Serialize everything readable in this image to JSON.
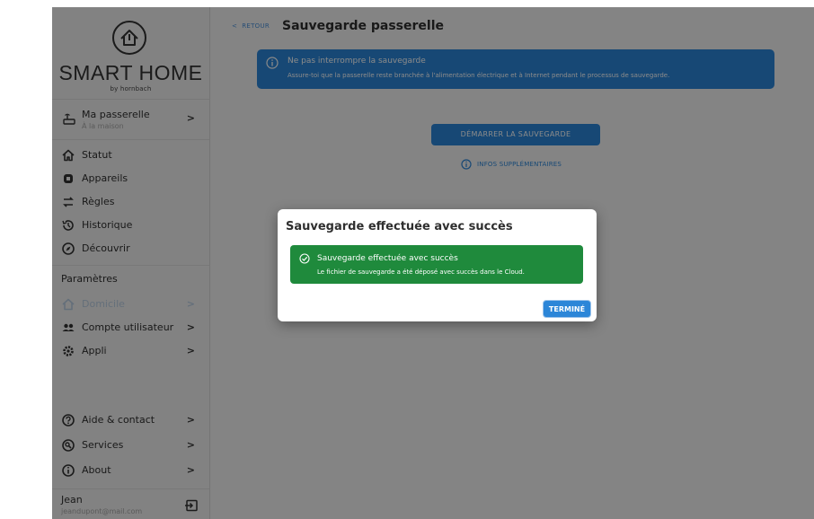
{
  "brand": {
    "title": "SMART HOME",
    "subtitle": "by hornbach"
  },
  "gateway": {
    "title": "Ma passerelle",
    "subtitle": "À la maison",
    "icon": "gateway-icon"
  },
  "nav": [
    {
      "label": "Statut",
      "icon": "home-icon"
    },
    {
      "label": "Appareils",
      "icon": "device-icon"
    },
    {
      "label": "Règles",
      "icon": "rules-icon"
    },
    {
      "label": "Historique",
      "icon": "history-icon"
    },
    {
      "label": "Découvrir",
      "icon": "compass-icon"
    }
  ],
  "settings": {
    "section_label": "Paramètres",
    "items": [
      {
        "label": "Domicile",
        "icon": "home-icon",
        "disabled": true
      },
      {
        "label": "Compte utilisateur",
        "icon": "users-icon"
      },
      {
        "label": "Appli",
        "icon": "gear-icon"
      }
    ]
  },
  "bottom_nav": [
    {
      "label": "Aide & contact",
      "icon": "help-icon"
    },
    {
      "label": "Services",
      "icon": "services-icon"
    },
    {
      "label": "About",
      "icon": "info-icon"
    }
  ],
  "user": {
    "name": "Jean",
    "email": "jeandupont@mail.com"
  },
  "header": {
    "back_label": "RETOUR",
    "title": "Sauvegarde passerelle"
  },
  "banner": {
    "title": "Ne pas interrompre la sauvegarde",
    "text": "Assure-toi que la passerelle reste branchée à l'alimentation électrique et à Internet pendant le processus de sauvegarde."
  },
  "actions": {
    "start_label": "DÉMARRER LA SAUVEGARDE",
    "infos_label": "INFOS SUPPLÉMENTAIRES"
  },
  "dialog": {
    "title": "Sauvegarde effectuée avec succès",
    "success_title": "Sauvegarde effectuée avec succès",
    "success_text": "Le fichier de sauvegarde a été déposé avec succès dans le Cloud.",
    "done_label": "TERMINÉ"
  },
  "colors": {
    "accent": "#2c86d8",
    "success": "#1f8a3c",
    "sidebar_bg": "#f1f1f1",
    "disabled": "#b9cde2"
  }
}
